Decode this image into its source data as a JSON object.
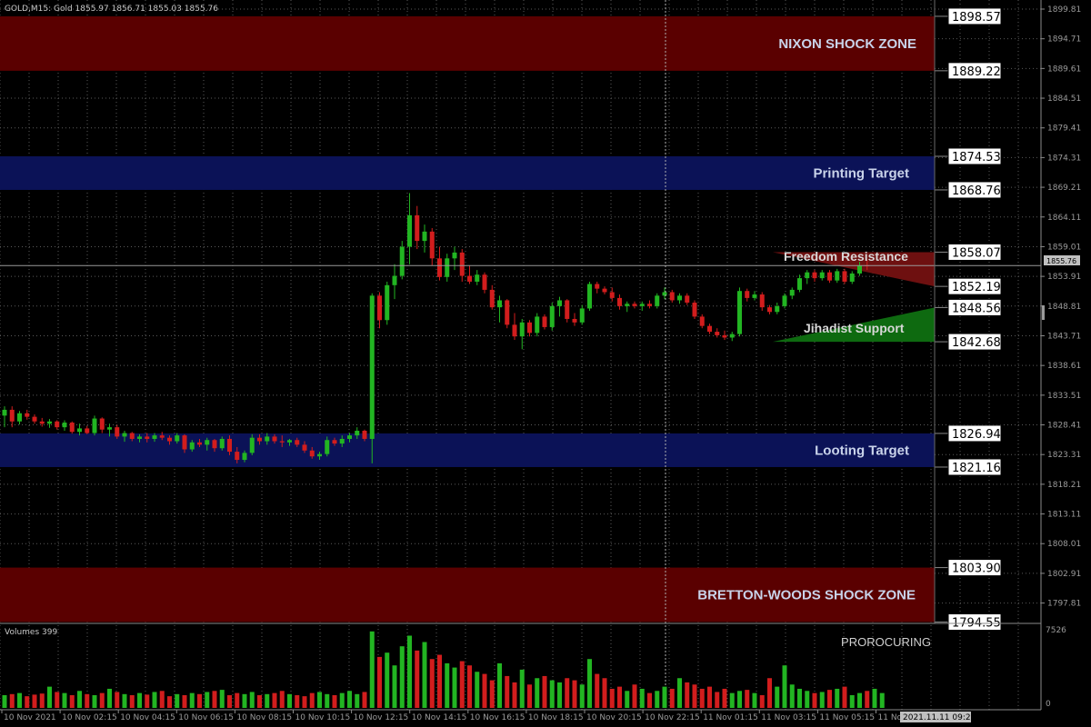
{
  "header": {
    "symbol_info": "GOLD,M15:  Gold  1855.97 1856.71 1855.03 1855.76"
  },
  "colors": {
    "background": "#000000",
    "grid": "#5a5a5a",
    "bull": "#22b522",
    "bear": "#d21d1d",
    "shock_zone": "#5a0000",
    "target_zone": "#0b1257",
    "axis_text": "#9a9a9a"
  },
  "zones": [
    {
      "label": "NIXON SHOCK ZONE",
      "top": 1898.57,
      "bottom": 1889.22,
      "kind": "shock"
    },
    {
      "label": "Printing Target",
      "top": 1874.53,
      "bottom": 1868.76,
      "kind": "target"
    },
    {
      "label": "Looting Target",
      "top": 1826.94,
      "bottom": 1821.16,
      "kind": "target"
    },
    {
      "label": "BRETTON-WOODS SHOCK ZONE",
      "top": 1803.9,
      "bottom": 1794.55,
      "kind": "shock"
    }
  ],
  "level_labels": [
    "1898.57",
    "1889.22",
    "1874.53",
    "1868.76",
    "1858.07",
    "1852.19",
    "1848.56",
    "1842.68",
    "1826.94",
    "1821.16",
    "1803.90",
    "1794.55"
  ],
  "annotations": {
    "freedom_resistance": "Freedom Resistance",
    "jihadist_support": "Jihadist Support",
    "prorocuring": "PROROCURING"
  },
  "price_axis": {
    "ticks": [
      "1899.81",
      "1894.71",
      "1889.61",
      "1884.51",
      "1879.41",
      "1874.31",
      "1869.21",
      "1864.11",
      "1859.01",
      "1853.91",
      "1848.81",
      "1843.71",
      "1838.61",
      "1833.51",
      "1828.41",
      "1823.31",
      "1818.21",
      "1813.11",
      "1808.01",
      "1802.91",
      "1797.81"
    ],
    "current_price": "1855.76"
  },
  "volume_panel": {
    "title": "Volumes 399",
    "max_label": "7526",
    "zero_label": "0"
  },
  "time_axis": {
    "labels": [
      "10 Nov 2021",
      "10 Nov 02:15",
      "10 Nov 04:15",
      "10 Nov 06:15",
      "10 Nov 08:15",
      "10 Nov 10:15",
      "10 Nov 12:15",
      "10 Nov 14:15",
      "10 Nov 16:15",
      "10 Nov 18:15",
      "10 Nov 20:15",
      "10 Nov 22:15",
      "11 Nov 01:15",
      "11 Nov 03:15",
      "11 Nov 05:15",
      "11 Nov 07:15"
    ],
    "cursor_label": "2021.11.11 09:20"
  },
  "chart_data": {
    "type": "candlestick",
    "timeframe": "M15",
    "symbol": "GOLD",
    "candles": [
      {
        "o": 1830.0,
        "h": 1831.6,
        "l": 1828.0,
        "c": 1831.0
      },
      {
        "o": 1831.0,
        "h": 1831.6,
        "l": 1828.0,
        "c": 1829.0
      },
      {
        "o": 1829.0,
        "h": 1830.8,
        "l": 1828.5,
        "c": 1830.4
      },
      {
        "o": 1830.4,
        "h": 1831.0,
        "l": 1829.3,
        "c": 1829.8
      },
      {
        "o": 1829.8,
        "h": 1830.2,
        "l": 1828.6,
        "c": 1829.0
      },
      {
        "o": 1829.0,
        "h": 1829.6,
        "l": 1828.1,
        "c": 1828.6
      },
      {
        "o": 1828.6,
        "h": 1829.4,
        "l": 1827.9,
        "c": 1829.0
      },
      {
        "o": 1829.0,
        "h": 1829.2,
        "l": 1827.6,
        "c": 1828.0
      },
      {
        "o": 1828.0,
        "h": 1829.2,
        "l": 1827.4,
        "c": 1828.8
      },
      {
        "o": 1828.8,
        "h": 1829.0,
        "l": 1826.9,
        "c": 1827.2
      },
      {
        "o": 1827.2,
        "h": 1828.6,
        "l": 1826.6,
        "c": 1827.8
      },
      {
        "o": 1827.8,
        "h": 1828.2,
        "l": 1826.8,
        "c": 1827.0
      },
      {
        "o": 1827.0,
        "h": 1830.0,
        "l": 1826.6,
        "c": 1829.5
      },
      {
        "o": 1829.5,
        "h": 1829.7,
        "l": 1827.0,
        "c": 1827.6
      },
      {
        "o": 1827.6,
        "h": 1828.6,
        "l": 1826.4,
        "c": 1828.0
      },
      {
        "o": 1828.0,
        "h": 1828.4,
        "l": 1826.0,
        "c": 1826.4
      },
      {
        "o": 1826.4,
        "h": 1827.4,
        "l": 1825.5,
        "c": 1827.0
      },
      {
        "o": 1827.0,
        "h": 1827.2,
        "l": 1825.6,
        "c": 1826.0
      },
      {
        "o": 1826.0,
        "h": 1826.8,
        "l": 1825.4,
        "c": 1826.4
      },
      {
        "o": 1826.4,
        "h": 1827.0,
        "l": 1825.4,
        "c": 1826.0
      },
      {
        "o": 1826.0,
        "h": 1827.0,
        "l": 1825.5,
        "c": 1826.6
      },
      {
        "o": 1826.6,
        "h": 1827.2,
        "l": 1825.8,
        "c": 1826.2
      },
      {
        "o": 1826.2,
        "h": 1826.6,
        "l": 1825.0,
        "c": 1825.6
      },
      {
        "o": 1825.6,
        "h": 1827.0,
        "l": 1825.2,
        "c": 1826.6
      },
      {
        "o": 1826.6,
        "h": 1826.8,
        "l": 1823.6,
        "c": 1824.2
      },
      {
        "o": 1824.2,
        "h": 1825.8,
        "l": 1823.8,
        "c": 1825.4
      },
      {
        "o": 1825.4,
        "h": 1826.0,
        "l": 1824.6,
        "c": 1825.0
      },
      {
        "o": 1825.0,
        "h": 1826.2,
        "l": 1824.0,
        "c": 1825.8
      },
      {
        "o": 1825.8,
        "h": 1826.0,
        "l": 1823.8,
        "c": 1824.4
      },
      {
        "o": 1824.4,
        "h": 1826.4,
        "l": 1824.0,
        "c": 1826.0
      },
      {
        "o": 1826.0,
        "h": 1826.6,
        "l": 1823.2,
        "c": 1823.8
      },
      {
        "o": 1823.8,
        "h": 1824.6,
        "l": 1821.8,
        "c": 1822.4
      },
      {
        "o": 1822.4,
        "h": 1824.0,
        "l": 1822.0,
        "c": 1823.6
      },
      {
        "o": 1823.6,
        "h": 1826.8,
        "l": 1823.2,
        "c": 1826.2
      },
      {
        "o": 1826.2,
        "h": 1826.8,
        "l": 1825.0,
        "c": 1825.6
      },
      {
        "o": 1825.6,
        "h": 1827.0,
        "l": 1825.0,
        "c": 1826.4
      },
      {
        "o": 1826.4,
        "h": 1826.8,
        "l": 1825.2,
        "c": 1825.6
      },
      {
        "o": 1825.6,
        "h": 1826.6,
        "l": 1824.6,
        "c": 1825.4
      },
      {
        "o": 1825.4,
        "h": 1826.0,
        "l": 1824.8,
        "c": 1825.8
      },
      {
        "o": 1825.8,
        "h": 1826.2,
        "l": 1824.6,
        "c": 1825.0
      },
      {
        "o": 1825.0,
        "h": 1825.6,
        "l": 1823.6,
        "c": 1824.0
      },
      {
        "o": 1824.0,
        "h": 1824.6,
        "l": 1822.6,
        "c": 1823.0
      },
      {
        "o": 1823.0,
        "h": 1823.8,
        "l": 1822.4,
        "c": 1823.4
      },
      {
        "o": 1823.4,
        "h": 1826.4,
        "l": 1823.0,
        "c": 1825.8
      },
      {
        "o": 1825.8,
        "h": 1826.2,
        "l": 1824.8,
        "c": 1825.2
      },
      {
        "o": 1825.2,
        "h": 1826.6,
        "l": 1824.6,
        "c": 1826.0
      },
      {
        "o": 1826.0,
        "h": 1827.0,
        "l": 1825.4,
        "c": 1826.6
      },
      {
        "o": 1826.6,
        "h": 1828.0,
        "l": 1826.0,
        "c": 1827.4
      },
      {
        "o": 1827.4,
        "h": 1827.6,
        "l": 1825.6,
        "c": 1826.0
      },
      {
        "o": 1826.0,
        "h": 1851.0,
        "l": 1821.8,
        "c": 1850.6
      },
      {
        "o": 1850.6,
        "h": 1851.2,
        "l": 1845.0,
        "c": 1846.4
      },
      {
        "o": 1846.4,
        "h": 1853.0,
        "l": 1845.6,
        "c": 1852.4
      },
      {
        "o": 1852.4,
        "h": 1856.0,
        "l": 1850.0,
        "c": 1854.0
      },
      {
        "o": 1854.0,
        "h": 1860.0,
        "l": 1853.4,
        "c": 1859.0
      },
      {
        "o": 1859.0,
        "h": 1868.2,
        "l": 1856.0,
        "c": 1864.4
      },
      {
        "o": 1864.4,
        "h": 1866.0,
        "l": 1858.6,
        "c": 1860.0
      },
      {
        "o": 1860.0,
        "h": 1862.8,
        "l": 1858.0,
        "c": 1861.6
      },
      {
        "o": 1861.6,
        "h": 1862.2,
        "l": 1855.8,
        "c": 1857.0
      },
      {
        "o": 1857.0,
        "h": 1859.0,
        "l": 1853.2,
        "c": 1853.8
      },
      {
        "o": 1853.8,
        "h": 1857.8,
        "l": 1853.0,
        "c": 1857.0
      },
      {
        "o": 1857.0,
        "h": 1859.0,
        "l": 1855.0,
        "c": 1858.0
      },
      {
        "o": 1858.0,
        "h": 1858.6,
        "l": 1853.0,
        "c": 1854.0
      },
      {
        "o": 1854.0,
        "h": 1855.8,
        "l": 1852.6,
        "c": 1853.0
      },
      {
        "o": 1853.0,
        "h": 1855.0,
        "l": 1852.4,
        "c": 1854.2
      },
      {
        "o": 1854.2,
        "h": 1854.6,
        "l": 1851.0,
        "c": 1851.6
      },
      {
        "o": 1851.6,
        "h": 1852.4,
        "l": 1848.2,
        "c": 1848.6
      },
      {
        "o": 1848.6,
        "h": 1850.6,
        "l": 1846.0,
        "c": 1849.8
      },
      {
        "o": 1849.8,
        "h": 1850.0,
        "l": 1845.0,
        "c": 1845.6
      },
      {
        "o": 1845.6,
        "h": 1847.6,
        "l": 1843.0,
        "c": 1843.6
      },
      {
        "o": 1843.6,
        "h": 1846.6,
        "l": 1841.4,
        "c": 1846.0
      },
      {
        "o": 1846.0,
        "h": 1846.4,
        "l": 1843.6,
        "c": 1844.2
      },
      {
        "o": 1844.2,
        "h": 1847.6,
        "l": 1843.6,
        "c": 1847.0
      },
      {
        "o": 1847.0,
        "h": 1847.4,
        "l": 1844.8,
        "c": 1845.2
      },
      {
        "o": 1845.2,
        "h": 1849.4,
        "l": 1844.6,
        "c": 1848.8
      },
      {
        "o": 1848.8,
        "h": 1850.4,
        "l": 1847.0,
        "c": 1849.8
      },
      {
        "o": 1849.8,
        "h": 1850.0,
        "l": 1846.0,
        "c": 1846.6
      },
      {
        "o": 1846.6,
        "h": 1847.6,
        "l": 1845.4,
        "c": 1846.0
      },
      {
        "o": 1846.0,
        "h": 1849.0,
        "l": 1845.6,
        "c": 1848.4
      },
      {
        "o": 1848.4,
        "h": 1853.0,
        "l": 1848.0,
        "c": 1852.6
      },
      {
        "o": 1852.6,
        "h": 1853.0,
        "l": 1851.0,
        "c": 1851.8
      },
      {
        "o": 1851.8,
        "h": 1852.2,
        "l": 1850.8,
        "c": 1851.2
      },
      {
        "o": 1851.2,
        "h": 1852.0,
        "l": 1849.6,
        "c": 1850.2
      },
      {
        "o": 1850.2,
        "h": 1850.8,
        "l": 1848.2,
        "c": 1848.8
      },
      {
        "o": 1848.8,
        "h": 1849.6,
        "l": 1847.8,
        "c": 1849.2
      },
      {
        "o": 1849.2,
        "h": 1849.6,
        "l": 1848.4,
        "c": 1848.8
      },
      {
        "o": 1848.8,
        "h": 1849.6,
        "l": 1848.0,
        "c": 1849.2
      },
      {
        "o": 1849.2,
        "h": 1849.8,
        "l": 1848.4,
        "c": 1848.8
      },
      {
        "o": 1848.8,
        "h": 1851.0,
        "l": 1848.4,
        "c": 1850.6
      },
      {
        "o": 1850.6,
        "h": 1852.0,
        "l": 1850.0,
        "c": 1851.2
      },
      {
        "o": 1851.2,
        "h": 1851.6,
        "l": 1849.4,
        "c": 1849.8
      },
      {
        "o": 1849.8,
        "h": 1851.0,
        "l": 1849.2,
        "c": 1850.6
      },
      {
        "o": 1850.6,
        "h": 1851.0,
        "l": 1849.0,
        "c": 1849.4
      },
      {
        "o": 1849.4,
        "h": 1849.8,
        "l": 1846.6,
        "c": 1847.0
      },
      {
        "o": 1847.0,
        "h": 1847.4,
        "l": 1845.0,
        "c": 1845.4
      },
      {
        "o": 1845.4,
        "h": 1845.8,
        "l": 1844.0,
        "c": 1844.4
      },
      {
        "o": 1844.4,
        "h": 1845.0,
        "l": 1843.4,
        "c": 1843.8
      },
      {
        "o": 1843.8,
        "h": 1844.6,
        "l": 1843.0,
        "c": 1843.4
      },
      {
        "o": 1843.4,
        "h": 1844.4,
        "l": 1842.8,
        "c": 1844.0
      },
      {
        "o": 1844.0,
        "h": 1852.0,
        "l": 1843.6,
        "c": 1851.4
      },
      {
        "o": 1851.4,
        "h": 1851.8,
        "l": 1849.6,
        "c": 1850.2
      },
      {
        "o": 1850.2,
        "h": 1851.4,
        "l": 1849.8,
        "c": 1850.8
      },
      {
        "o": 1850.8,
        "h": 1851.2,
        "l": 1848.0,
        "c": 1848.6
      },
      {
        "o": 1848.6,
        "h": 1849.0,
        "l": 1847.4,
        "c": 1847.8
      },
      {
        "o": 1847.8,
        "h": 1849.4,
        "l": 1847.4,
        "c": 1848.8
      },
      {
        "o": 1848.8,
        "h": 1851.0,
        "l": 1848.4,
        "c": 1850.6
      },
      {
        "o": 1850.6,
        "h": 1852.0,
        "l": 1850.0,
        "c": 1851.6
      },
      {
        "o": 1851.6,
        "h": 1854.2,
        "l": 1851.2,
        "c": 1853.6
      },
      {
        "o": 1853.6,
        "h": 1855.0,
        "l": 1852.6,
        "c": 1854.6
      },
      {
        "o": 1854.6,
        "h": 1855.0,
        "l": 1853.0,
        "c": 1853.6
      },
      {
        "o": 1853.6,
        "h": 1855.0,
        "l": 1853.2,
        "c": 1854.6
      },
      {
        "o": 1854.6,
        "h": 1855.0,
        "l": 1852.8,
        "c": 1853.2
      },
      {
        "o": 1853.2,
        "h": 1855.2,
        "l": 1852.8,
        "c": 1854.8
      },
      {
        "o": 1854.8,
        "h": 1855.2,
        "l": 1852.6,
        "c": 1853.0
      },
      {
        "o": 1853.0,
        "h": 1854.8,
        "l": 1852.6,
        "c": 1854.4
      },
      {
        "o": 1854.4,
        "h": 1856.4,
        "l": 1854.0,
        "c": 1855.8
      },
      {
        "o": 1855.8,
        "h": 1856.8,
        "l": 1855.0,
        "c": 1855.76
      }
    ],
    "volumes": [
      1200,
      1300,
      1400,
      1100,
      1250,
      1350,
      2000,
      1500,
      1400,
      1200,
      1600,
      1300,
      1200,
      1400,
      1800,
      1500,
      1300,
      1200,
      1400,
      1250,
      1500,
      1600,
      1100,
      1300,
      1200,
      1400,
      1300,
      1500,
      1600,
      1700,
      1200,
      1400,
      1300,
      1500,
      1200,
      1300,
      1400,
      1600,
      1300,
      1200,
      1100,
      1400,
      1500,
      1300,
      1200,
      1400,
      1600,
      1300,
      1500,
      7200,
      4800,
      5200,
      4000,
      5800,
      6800,
      5400,
      6200,
      4600,
      5000,
      4200,
      3800,
      4400,
      4000,
      3400,
      3200,
      2600,
      4200,
      3000,
      2400,
      3600,
      2200,
      2800,
      3000,
      2600,
      2400,
      2800,
      2600,
      2200,
      4600,
      3200,
      2800,
      1800,
      2000,
      1600,
      2200,
      1800,
      1400,
      1600,
      2000,
      1800,
      2800,
      2400,
      2200,
      1800,
      2000,
      1500,
      1800,
      1400,
      1600,
      1700,
      1400,
      1200,
      2800,
      2000,
      4000,
      2200,
      1800,
      1600,
      1400,
      1500,
      1700,
      1800,
      2000,
      1200,
      1400,
      1600,
      1800,
      1400
    ]
  }
}
